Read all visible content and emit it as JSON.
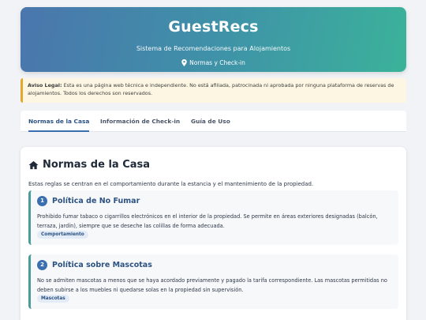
{
  "header": {
    "title": "GuestRecs",
    "subtitle": "Sistema de Recomendaciones para Alojamientos",
    "location_label": "Normas y Check-in",
    "location_icon": "map-pin-icon"
  },
  "notice": {
    "label": "Aviso Legal:",
    "text": " Esta es una página web técnica e independiente. No está afiliada, patrocinada ni aprobada por ninguna plataforma de reservas de alojamientos. Todos los derechos son reservados."
  },
  "tabs": [
    {
      "label": "Normas de la Casa",
      "active": true
    },
    {
      "label": "Información de Check-in",
      "active": false
    },
    {
      "label": "Guía de Uso",
      "active": false
    }
  ],
  "section": {
    "icon": "home-icon",
    "title": "Normas de la Casa",
    "intro": "Estas reglas se centran en el comportamiento durante la estancia y el mantenimiento de la propiedad."
  },
  "rules": [
    {
      "number": "1",
      "title": "Política de No Fumar",
      "text": "Prohibido fumar tabaco o cigarrillos electrónicos en el interior de la propiedad. Se permite en áreas exteriores designadas (balcón, terraza, jardín), siempre que se deseche las colillas de forma adecuada.",
      "tag": "Comportamiento"
    },
    {
      "number": "2",
      "title": "Política sobre Mascotas",
      "text": "No se admiten mascotas a menos que se haya acordado previamente y pagado la tarifa correspondiente. Las mascotas permitidas no deben subirse a los muebles ni quedarse solas en la propiedad sin supervisión.",
      "tag": "Mascotas"
    }
  ],
  "colors": {
    "accent": "#3b6fb0",
    "header_gradient_start": "#4a76ad",
    "header_gradient_end": "#3bb29a",
    "notice_border": "#e0a82e"
  }
}
